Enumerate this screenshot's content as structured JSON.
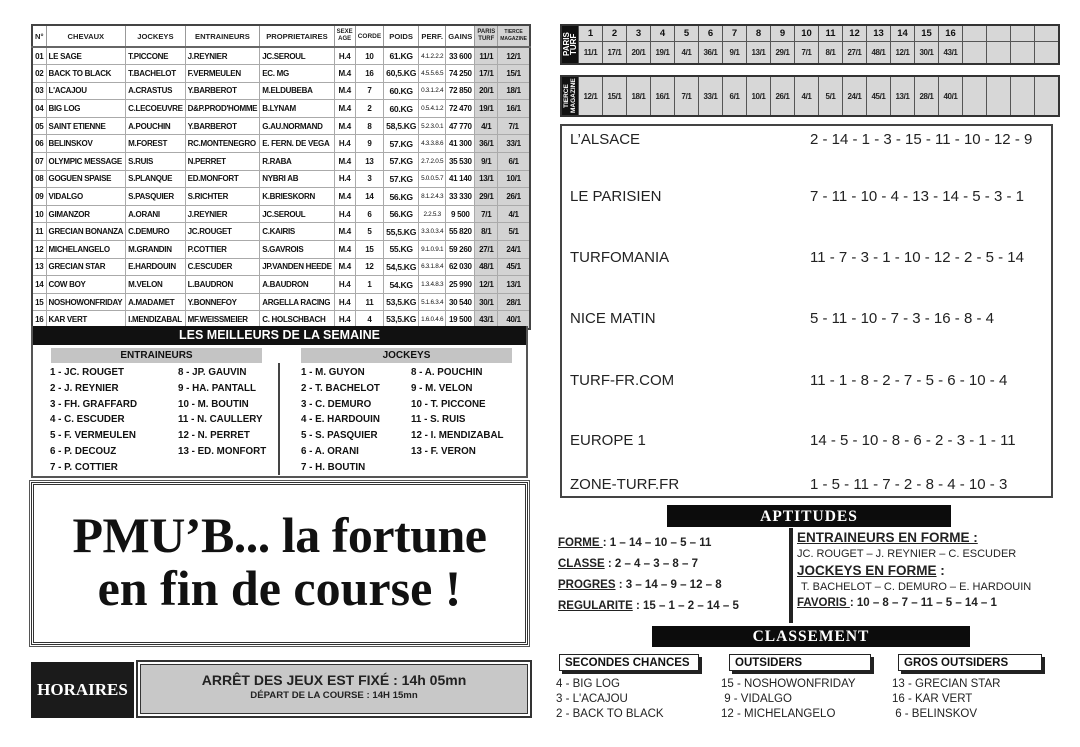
{
  "runners": {
    "headers": [
      "N°",
      "CHEVAUX",
      "JOCKEYS",
      "ENTRAINEURS",
      "PROPRIETAIRES",
      "SEXE AGE",
      "CORDE",
      "POIDS",
      "PERF.",
      "GAINS",
      "PARIS TURF",
      "TIERCE MAGAZINE"
    ],
    "rows": [
      [
        "01",
        "LE SAGE",
        "T.PICCONE",
        "J.REYNIER",
        "JC.SEROUL",
        "H.4",
        "10",
        "61.KG",
        "4.1.2.2.2",
        "33 600",
        "11/1",
        "12/1"
      ],
      [
        "02",
        "BACK TO BLACK",
        "T.BACHELOT",
        "F.VERMEULEN",
        "EC. MG",
        "M.4",
        "16",
        "60,5.KG",
        "4.5.5.6.5",
        "74 250",
        "17/1",
        "15/1"
      ],
      [
        "03",
        "L'ACAJOU",
        "A.CRASTUS",
        "Y.BARBEROT",
        "M.ELDUBEBA",
        "M.4",
        "7",
        "60.KG",
        "0.3.1.2.4",
        "72 850",
        "20/1",
        "18/1"
      ],
      [
        "04",
        "BIG LOG",
        "C.LECOEUVRE",
        "D&P.PROD'HOMME",
        "B.LYNAM",
        "M.4",
        "2",
        "60.KG",
        "0.5.4.1.2",
        "72 470",
        "19/1",
        "16/1"
      ],
      [
        "05",
        "SAINT ETIENNE",
        "A.POUCHIN",
        "Y.BARBEROT",
        "G.AU.NORMAND",
        "M.4",
        "8",
        "58,5.KG",
        "5.2.3.0.1",
        "47 770",
        "4/1",
        "7/1"
      ],
      [
        "06",
        "BELINSKOV",
        "M.FOREST",
        "RC.MONTENEGRO",
        "E. FERN. DE VEGA",
        "H.4",
        "9",
        "57.KG",
        "4.3.3.8.6",
        "41 300",
        "36/1",
        "33/1"
      ],
      [
        "07",
        "OLYMPIC MESSAGE",
        "S.RUIS",
        "N.PERRET",
        "R.RABA",
        "M.4",
        "13",
        "57.KG",
        "2.7.2.0.5",
        "35 530",
        "9/1",
        "6/1"
      ],
      [
        "08",
        "GOGUEN SPAISE",
        "S.PLANQUE",
        "ED.MONFORT",
        "NYBRI AB",
        "H.4",
        "3",
        "57.KG",
        "5.0.0.5.7",
        "41 140",
        "13/1",
        "10/1"
      ],
      [
        "09",
        "VIDALGO",
        "S.PASQUIER",
        "S.RICHTER",
        "K.BRIESKORN",
        "M.4",
        "14",
        "56.KG",
        "8.1.2.4.3",
        "33 330",
        "29/1",
        "26/1"
      ],
      [
        "10",
        "GIMANZOR",
        "A.ORANI",
        "J.REYNIER",
        "JC.SEROUL",
        "H.4",
        "6",
        "56.KG",
        "2.2.5.3",
        "9 500",
        "7/1",
        "4/1"
      ],
      [
        "11",
        "GRECIAN BONANZA",
        "C.DEMURO",
        "JC.ROUGET",
        "C.KAIRIS",
        "M.4",
        "5",
        "55,5.KG",
        "3.3.0.3.4",
        "55 820",
        "8/1",
        "5/1"
      ],
      [
        "12",
        "MICHELANGELO",
        "M.GRANDIN",
        "P.COTTIER",
        "S.GAVROIS",
        "M.4",
        "15",
        "55.KG",
        "9.1.0.9.1",
        "59 260",
        "27/1",
        "24/1"
      ],
      [
        "13",
        "GRECIAN STAR",
        "E.HARDOUIN",
        "C.ESCUDER",
        "JP.VANDEN HEEDE",
        "M.4",
        "12",
        "54,5.KG",
        "6.3.1.8.4",
        "62 030",
        "48/1",
        "45/1"
      ],
      [
        "14",
        "COW BOY",
        "M.VELON",
        "L.BAUDRON",
        "A.BAUDRON",
        "H.4",
        "1",
        "54.KG",
        "1.3.4.8.3",
        "25 990",
        "12/1",
        "13/1"
      ],
      [
        "15",
        "NOSHOWONFRIDAY",
        "A.MADAMET",
        "Y.BONNEFOY",
        "ARGELLA RACING",
        "H.4",
        "11",
        "53,5.KG",
        "5.1.6.3.4",
        "30 540",
        "30/1",
        "28/1"
      ],
      [
        "16",
        "KAR VERT",
        "I.MENDIZABAL",
        "MF.WEISSMEIER",
        "C. HOLSCHBACH",
        "H.4",
        "4",
        "53,5.KG",
        "1.6.0.4.6",
        "19 500",
        "43/1",
        "40/1"
      ]
    ]
  },
  "meilleurs": {
    "title": "LES MEILLEURS DE LA SEMAINE",
    "entraineurs_label": "ENTRAINEURS",
    "jockeys_label": "JOCKEYS",
    "entraineurs_a": [
      "1 - JC. ROUGET",
      "2 - J. REYNIER",
      "3 - FH. GRAFFARD",
      "4 - C. ESCUDER",
      "5 - F. VERMEULEN",
      "6 - P. DECOUZ",
      "7 - P. COTTIER"
    ],
    "entraineurs_b": [
      "8 - JP. GAUVIN",
      "9 - HA. PANTALL",
      "10 - M. BOUTIN",
      "11 - N. CAULLERY",
      "12 - N. PERRET",
      "13 - ED. MONFORT"
    ],
    "jockeys_a": [
      "1 - M. GUYON",
      "2 - T. BACHELOT",
      "3 - C. DEMURO",
      "4 - E. HARDOUIN",
      "5 - S. PASQUIER",
      "6 - A. ORANI",
      "7 - H. BOUTIN"
    ],
    "jockeys_b": [
      "8 - A. POUCHIN",
      "9 - M. VELON",
      "10 - T. PICCONE",
      "11 - S. RUIS",
      "12 - I. MENDIZABAL",
      "13 - F. VERON"
    ]
  },
  "slogan": {
    "line1": "PMU’B... la fortune",
    "line2": "en fin de course !"
  },
  "horaires": {
    "label": "HORAIRES",
    "main": "ARRÊT DES JEUX EST FIXÉ : 14h 05mn",
    "sub": "DÉPART DE LA COURSE : 14H 15mn"
  },
  "cotes": {
    "paris_turf": {
      "label": "PARIS TURF",
      "numbers": [
        "1",
        "2",
        "3",
        "4",
        "5",
        "6",
        "7",
        "8",
        "9",
        "10",
        "11",
        "12",
        "13",
        "14",
        "15",
        "16",
        "",
        "",
        "",
        ""
      ],
      "values": [
        "11/1",
        "17/1",
        "20/1",
        "19/1",
        "4/1",
        "36/1",
        "9/1",
        "13/1",
        "29/1",
        "7/1",
        "8/1",
        "27/1",
        "48/1",
        "12/1",
        "30/1",
        "43/1",
        "",
        "",
        "",
        ""
      ]
    },
    "tierce_magazine": {
      "label": "TIERCE MAGAZINE",
      "values": [
        "12/1",
        "15/1",
        "18/1",
        "16/1",
        "7/1",
        "33/1",
        "6/1",
        "10/1",
        "26/1",
        "4/1",
        "5/1",
        "24/1",
        "45/1",
        "13/1",
        "28/1",
        "40/1",
        "",
        "",
        "",
        ""
      ]
    }
  },
  "pronostics": [
    {
      "source": "L’ALSACE",
      "selection": "2 - 14 - 1 - 3 - 15 - 11 - 10 - 12 - 9"
    },
    {
      "source": "LE PARISIEN",
      "selection": "7 - 11 - 10 - 4 - 13 - 14 - 5 - 3 - 1"
    },
    {
      "source": "TURFOMANIA",
      "selection": "11 - 7 - 3 - 1 - 10 - 12 - 2 - 5 - 14"
    },
    {
      "source": "NICE MATIN",
      "selection": "5 - 11 - 10 - 7 - 3 - 16 - 8 - 4"
    },
    {
      "source": "TURF-FR.COM",
      "selection": "11 - 1 - 8 - 2 - 7 - 5 - 6 - 10 - 4"
    },
    {
      "source": "EUROPE 1",
      "selection": "14 - 5 - 10 - 8 - 6 - 2 - 3 - 1 - 11"
    },
    {
      "source": "ZONE-TURF.FR",
      "selection": "1 - 5 - 11 - 7 - 2 - 8 - 4 - 10 - 3"
    }
  ],
  "aptitudes": {
    "title": "APTITUDES",
    "items": [
      {
        "key": "FORME ",
        "value": ": 1 – 14 – 10 – 5 – 11"
      },
      {
        "key": "CLASSE",
        "value": " : 2 – 4 – 3 – 8 – 7"
      },
      {
        "key": "PROGRES",
        "value": " : 3 – 14 – 9 – 12 – 8"
      },
      {
        "key": "REGULARITE",
        "value": " : 15 – 1 – 2 – 14 – 5"
      }
    ],
    "entraineurs_title": "ENTRAINEURS EN FORME :",
    "entraineurs": "JC. ROUGET – J. REYNIER – C. ESCUDER",
    "jockeys_title": "JOCKEYS EN FORME",
    "jockeys_colon": " :",
    "jockeys": "T. BACHELOT – C. DEMURO – E. HARDOUIN",
    "favoris_key": "FAVORIS ",
    "favoris_value": ": 10 – 8 – 7 – 11 – 5 – 14 – 1"
  },
  "classement": {
    "title": "CLASSEMENT",
    "groups": [
      {
        "label": "SECONDES CHANCES",
        "items": [
          "4 - BIG LOG",
          "3 - L'ACAJOU",
          "2 - BACK TO BLACK"
        ]
      },
      {
        "label": "OUTSIDERS",
        "items": [
          "15 - NOSHOWONFRIDAY",
          " 9 - VIDALGO",
          "12 - MICHELANGELO"
        ]
      },
      {
        "label": "GROS OUTSIDERS",
        "items": [
          "13 - GRECIAN STAR",
          "16 - KAR VERT",
          " 6 - BELINSKOV"
        ]
      }
    ]
  }
}
